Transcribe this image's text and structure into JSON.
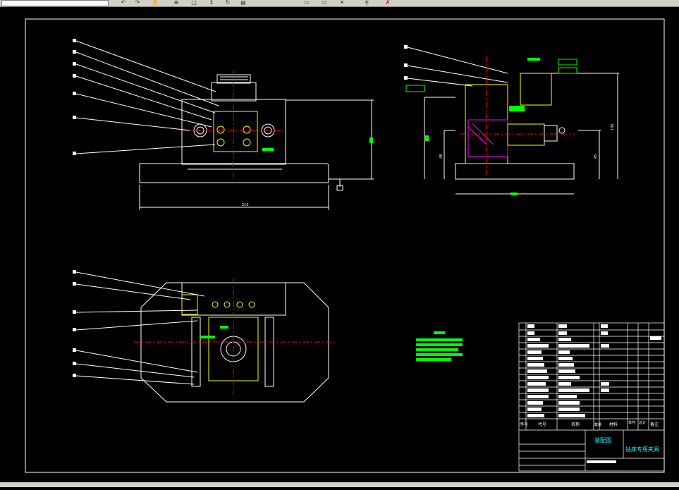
{
  "toolbar": {
    "buttons": [
      "undo-icon",
      "redo-icon",
      "pan-icon",
      "zoom-icon",
      "zoom-window-icon",
      "zoom-previous-icon",
      "rotate-icon",
      "properties-icon",
      "match-icon",
      "copy-icon",
      "paste-icon",
      "cut-icon",
      "help-icon"
    ]
  },
  "drawing": {
    "title_block": {
      "drawing_name": "装配图",
      "product_name": "钻床专用夹具",
      "header_cols": [
        "序号",
        "代号",
        "名称",
        "数量",
        "材料",
        "单件",
        "总计",
        "备注"
      ]
    },
    "views": {
      "front": {
        "width_dimension": "210"
      },
      "side": {
        "height_dimension": "136",
        "left_dimension": "48",
        "right_dimension": "45"
      }
    },
    "colors": {
      "background": "#000000",
      "outline": "#ffffff",
      "section": "#ffff00",
      "centerline": "#ff0000",
      "dimension": "#00ff00",
      "hatch": "#ff00ff",
      "part": "#00ffff"
    }
  }
}
